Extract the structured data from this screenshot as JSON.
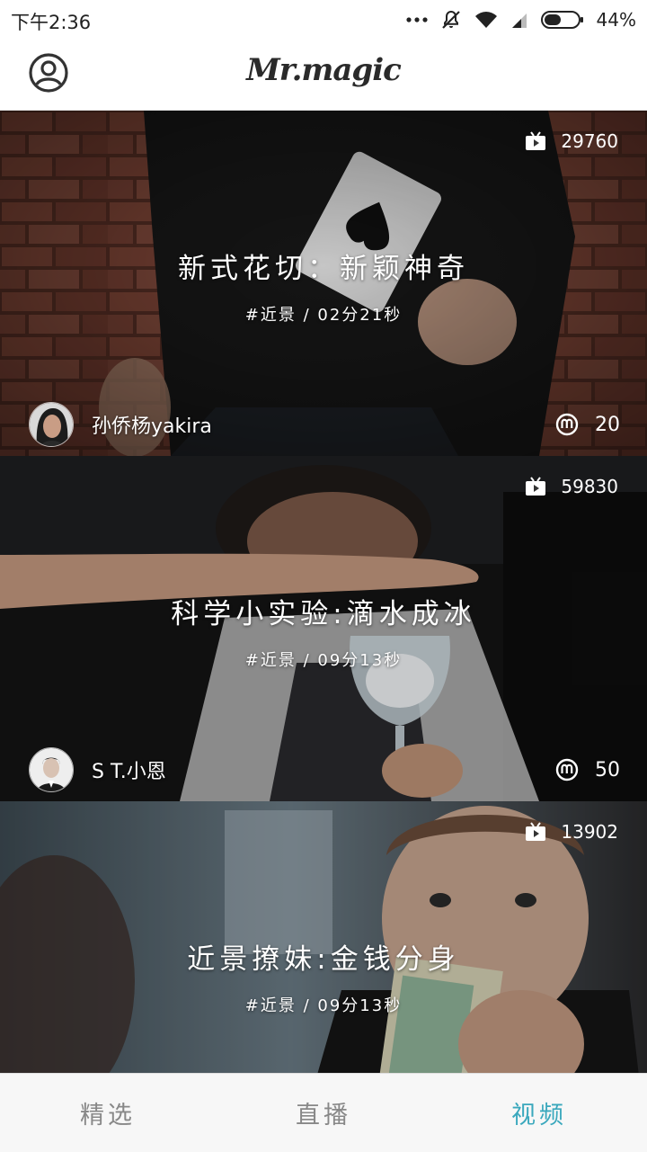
{
  "status_bar": {
    "time": "下午2:36",
    "battery": "44%",
    "icons": [
      "more-dots-icon",
      "mute-icon",
      "wifi-icon",
      "signal-icon",
      "battery-icon"
    ]
  },
  "header": {
    "title": "Mr.magic",
    "profile_icon": "user-circle-icon"
  },
  "feed": [
    {
      "views": "29760",
      "title": "新式花切：新颖神奇",
      "meta": "#近景 / 02分21秒",
      "author": "孙侨杨yakira",
      "likes": "20"
    },
    {
      "views": "59830",
      "title": "科学小实验:滴水成冰",
      "meta": "#近景 / 09分13秒",
      "author": "S T.小恩",
      "likes": "50"
    },
    {
      "views": "13902",
      "title": "近景撩妹:金钱分身",
      "meta": "#近景 / 09分13秒"
    }
  ],
  "nav": {
    "tabs": [
      "精选",
      "直播",
      "视频"
    ],
    "active": "视频",
    "active_color": "#3aa8bd"
  }
}
